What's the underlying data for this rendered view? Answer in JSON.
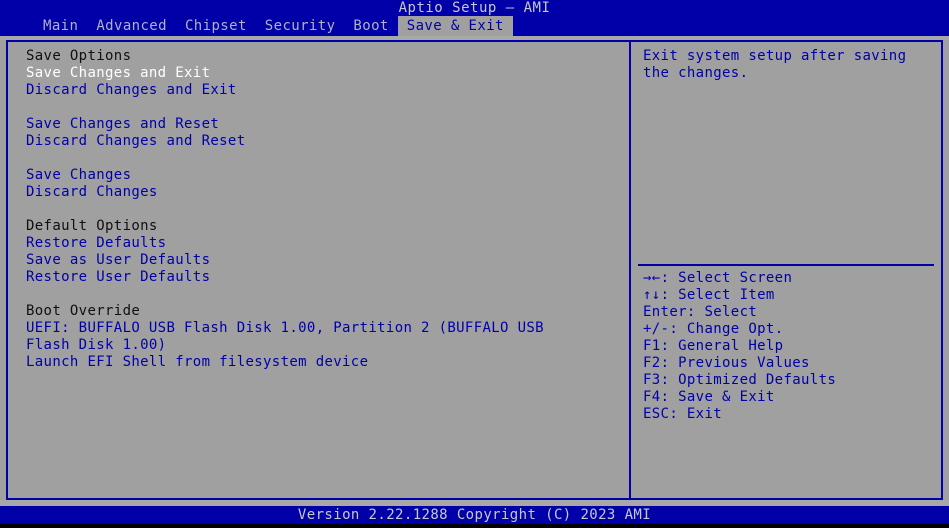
{
  "header": {
    "title": "Aptio Setup – AMI",
    "menu": [
      {
        "label": "Main",
        "active": false
      },
      {
        "label": "Advanced",
        "active": false
      },
      {
        "label": "Chipset",
        "active": false
      },
      {
        "label": "Security",
        "active": false
      },
      {
        "label": "Boot",
        "active": false
      },
      {
        "label": "Save & Exit",
        "active": true
      }
    ]
  },
  "left_pane": {
    "lines": [
      {
        "text": "Save Options",
        "style": "header"
      },
      {
        "text": "Save Changes and Exit",
        "style": "selected"
      },
      {
        "text": "Discard Changes and Exit",
        "style": "item"
      },
      {
        "text": "",
        "style": "blank"
      },
      {
        "text": "Save Changes and Reset",
        "style": "item"
      },
      {
        "text": "Discard Changes and Reset",
        "style": "item"
      },
      {
        "text": "",
        "style": "blank"
      },
      {
        "text": "Save Changes",
        "style": "item"
      },
      {
        "text": "Discard Changes",
        "style": "item"
      },
      {
        "text": "",
        "style": "blank"
      },
      {
        "text": "Default Options",
        "style": "header"
      },
      {
        "text": "Restore Defaults",
        "style": "item"
      },
      {
        "text": "Save as User Defaults",
        "style": "item"
      },
      {
        "text": "Restore User Defaults",
        "style": "item"
      },
      {
        "text": "",
        "style": "blank"
      },
      {
        "text": "Boot Override",
        "style": "header"
      },
      {
        "text": "UEFI: BUFFALO USB Flash Disk 1.00, Partition 2 (BUFFALO USB Flash Disk 1.00)",
        "style": "wrap"
      },
      {
        "text": "Launch EFI Shell from filesystem device",
        "style": "item"
      }
    ]
  },
  "right_pane": {
    "help": "Exit system setup after saving the changes.",
    "keys": [
      {
        "glyph": "→←",
        "label": ": Select Screen"
      },
      {
        "glyph": "↑↓",
        "label": ": Select Item"
      },
      {
        "glyph": "Enter",
        "label": ": Select"
      },
      {
        "glyph": "+/-",
        "label": ": Change Opt."
      },
      {
        "glyph": "F1",
        "label": ": General Help"
      },
      {
        "glyph": "F2",
        "label": ": Previous Values"
      },
      {
        "glyph": "F3",
        "label": ": Optimized Defaults"
      },
      {
        "glyph": "F4",
        "label": ": Save & Exit"
      },
      {
        "glyph": "ESC",
        "label": ": Exit"
      }
    ]
  },
  "footer": {
    "version_text": "Version 2.22.1288 Copyright (C) 2023 AMI"
  },
  "colors": {
    "background_gray": "#a0a0a0",
    "bios_blue": "#0000a8",
    "selected_white": "#ffffff",
    "header_black": "#101010",
    "footer_text": "#c8c8c8"
  }
}
